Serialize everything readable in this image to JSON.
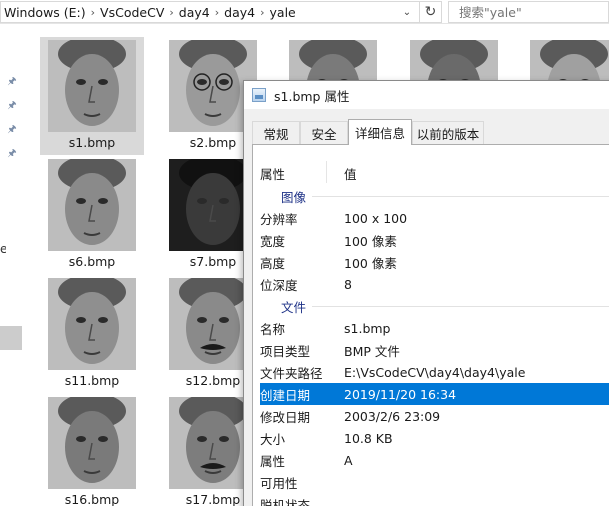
{
  "address": {
    "crumbs": [
      "Windows (E:)",
      "VsCodeCV",
      "day4",
      "day4",
      "yale"
    ],
    "separator": "›",
    "dropdown_icon": "chevron-down-icon",
    "refresh_icon": "refresh-icon"
  },
  "search": {
    "placeholder": "搜索\"yale\""
  },
  "nav": {
    "partial_label": "e"
  },
  "files": [
    {
      "name": "s1.bmp"
    },
    {
      "name": "s2.bmp"
    },
    {
      "name": ""
    },
    {
      "name": ""
    },
    {
      "name": ""
    },
    {
      "name": "s6.bmp"
    },
    {
      "name": "s7.bmp"
    },
    {
      "name": "s11.bmp"
    },
    {
      "name": "s12.bmp"
    },
    {
      "name": "s16.bmp"
    },
    {
      "name": "s17.bmp"
    }
  ],
  "dialog": {
    "title": "s1.bmp 属性",
    "tabs": [
      "常规",
      "安全",
      "详细信息",
      "以前的版本"
    ],
    "active_tab": "详细信息",
    "header": {
      "property": "属性",
      "value": "值"
    },
    "sections": {
      "image": "图像",
      "file": "文件"
    },
    "image_props": [
      {
        "key": "分辨率",
        "value": "100 x 100"
      },
      {
        "key": "宽度",
        "value": "100 像素"
      },
      {
        "key": "高度",
        "value": "100 像素"
      },
      {
        "key": "位深度",
        "value": "8"
      }
    ],
    "file_props": [
      {
        "key": "名称",
        "value": "s1.bmp"
      },
      {
        "key": "项目类型",
        "value": "BMP 文件"
      },
      {
        "key": "文件夹路径",
        "value": "E:\\VsCodeCV\\day4\\day4\\yale"
      },
      {
        "key": "创建日期",
        "value": "2019/11/20 16:34",
        "selected": true
      },
      {
        "key": "修改日期",
        "value": "2003/2/6 23:09"
      },
      {
        "key": "大小",
        "value": "10.8 KB"
      },
      {
        "key": "属性",
        "value": "A"
      },
      {
        "key": "可用性",
        "value": ""
      },
      {
        "key": "脱机状态",
        "value": ""
      }
    ]
  },
  "colors": {
    "selection": "#0078d7",
    "section": "#1e3287"
  }
}
